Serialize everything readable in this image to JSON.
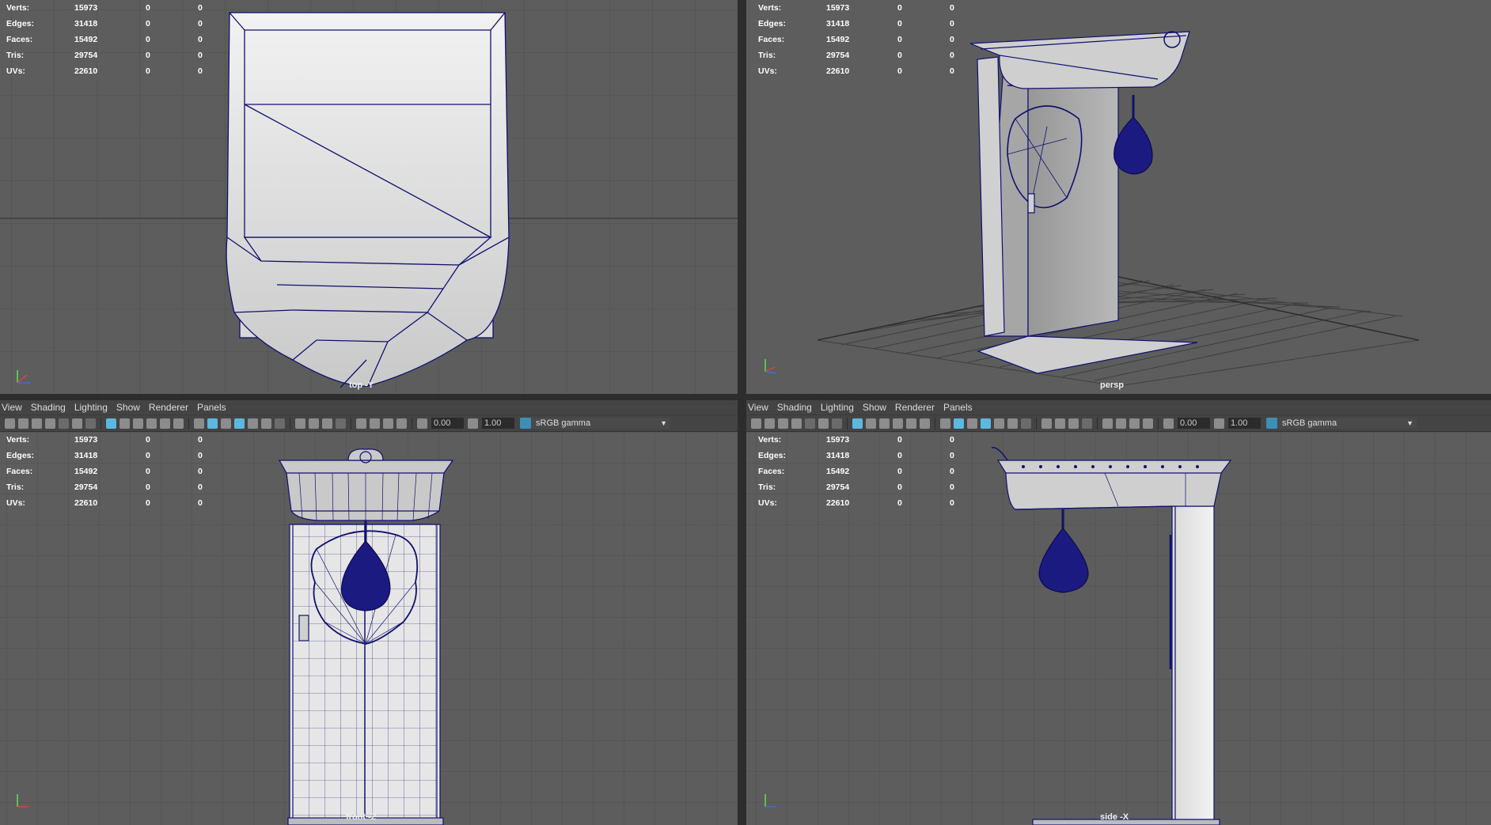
{
  "menu": [
    "View",
    "Shading",
    "Lighting",
    "Show",
    "Renderer",
    "Panels"
  ],
  "toolbar": {
    "field1": "0.00",
    "field2": "1.00",
    "colorspace": "sRGB gamma"
  },
  "hud": [
    {
      "label": "Verts:",
      "v1": "15973",
      "v2": "0",
      "v3": "0"
    },
    {
      "label": "Edges:",
      "v1": "31418",
      "v2": "0",
      "v3": "0"
    },
    {
      "label": "Faces:",
      "v1": "15492",
      "v2": "0",
      "v3": "0"
    },
    {
      "label": "Tris:",
      "v1": "29754",
      "v2": "0",
      "v3": "0"
    },
    {
      "label": "UVs:",
      "v1": "22610",
      "v2": "0",
      "v3": "0"
    }
  ],
  "cameras": {
    "top": "top -Y",
    "persp": "persp",
    "front": "front -Z",
    "side": "side -X"
  }
}
